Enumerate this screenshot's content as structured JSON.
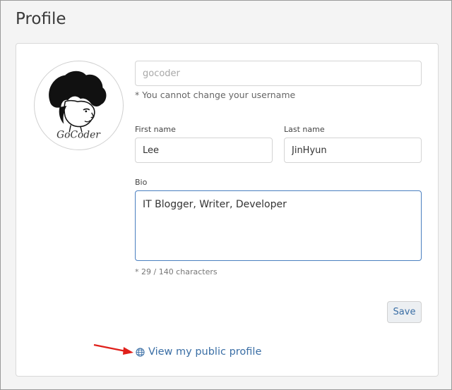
{
  "page": {
    "title": "Profile"
  },
  "avatar": {
    "caption": "GoCoder"
  },
  "username": {
    "value": "gocoder",
    "hint": "* You cannot change your username"
  },
  "first_name": {
    "label": "First name",
    "value": "Lee"
  },
  "last_name": {
    "label": "Last name",
    "value": "JinHyun"
  },
  "bio": {
    "label": "Bio",
    "value": "IT Blogger, Writer, Developer",
    "counter": "* 29 / 140 characters"
  },
  "actions": {
    "save_label": "Save",
    "public_profile_label": "View my public profile"
  },
  "icons": {
    "link": "globe-icon",
    "annotation": "red-arrow-icon"
  },
  "colors": {
    "accent": "#3a6ea5",
    "annotation": "#e0201b",
    "focus_border": "#4a7fc0"
  }
}
